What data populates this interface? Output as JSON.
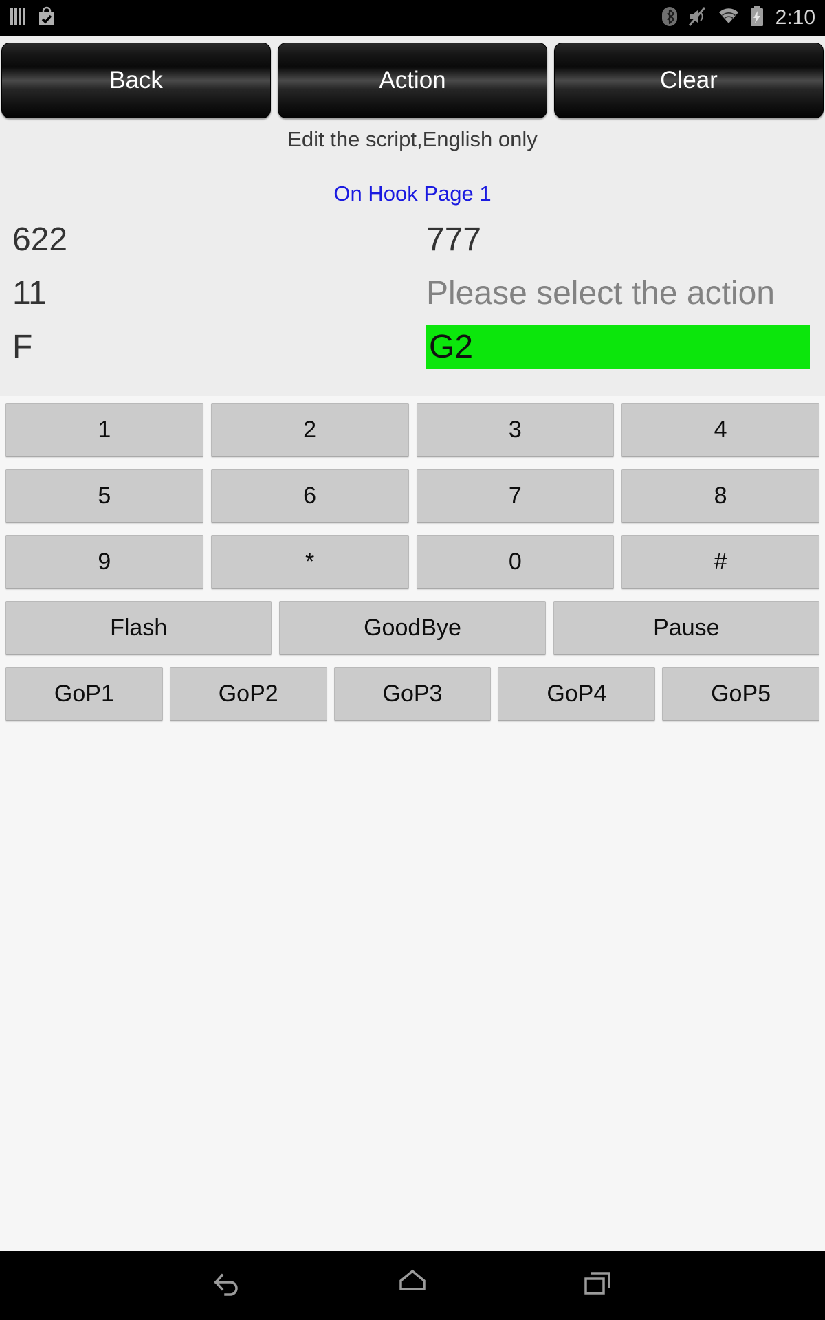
{
  "status_bar": {
    "left_icons": [
      {
        "name": "barcode-icon",
        "glyph": "barcode"
      },
      {
        "name": "play-store-bag-check-icon",
        "glyph": "bag-check"
      }
    ],
    "right_icons": [
      {
        "name": "bluetooth-icon",
        "glyph": "bluetooth"
      },
      {
        "name": "volume-muted-icon",
        "glyph": "volume-muted"
      },
      {
        "name": "wifi-icon",
        "glyph": "wifi"
      },
      {
        "name": "battery-charging-icon",
        "glyph": "battery-charging"
      }
    ],
    "clock": "2:10",
    "background": "#000000",
    "icon_color": "#9e9e9e",
    "clock_color": "#d8d8d8"
  },
  "toolbar": {
    "back_label": "Back",
    "action_label": "Action",
    "clear_label": "Clear"
  },
  "header": {
    "hint": "Edit the script,English only",
    "page_title": "On Hook Page 1",
    "page_title_color": "#1a1ae0"
  },
  "script_rows": [
    {
      "left": "622",
      "right": "777",
      "right_style": "value"
    },
    {
      "left": "11",
      "right": "Please select the action",
      "right_style": "placeholder"
    },
    {
      "left": "F",
      "right": "G2",
      "right_style": "highlight"
    }
  ],
  "highlight_color": "#0ce60c",
  "placeholder_color": "#828282",
  "keypad": {
    "row1": [
      "1",
      "2",
      "3",
      "4"
    ],
    "row2": [
      "5",
      "6",
      "7",
      "8"
    ],
    "row3": [
      "9",
      "*",
      "0",
      "#"
    ]
  },
  "function_row": [
    "Flash",
    "GoodBye",
    "Pause"
  ],
  "gop_row": [
    "GoP1",
    "GoP2",
    "GoP3",
    "GoP4",
    "GoP5"
  ],
  "nav_bar": {
    "back": "back-icon",
    "home": "home-icon",
    "recents": "recents-icon",
    "background": "#000000",
    "icon_color": "#9b9b9b"
  }
}
